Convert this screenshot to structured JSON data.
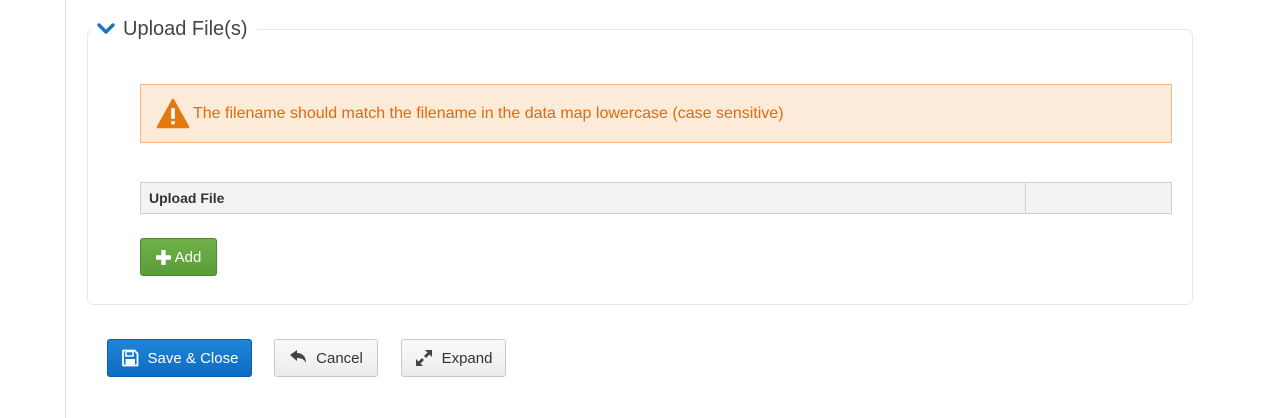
{
  "section": {
    "title": "Upload File(s)",
    "toggle_icon": "chevron-down-icon",
    "accent_color": "#1a73c5"
  },
  "alert": {
    "icon": "warning-triangle-icon",
    "message": "The filename should match the filename in the data map lowercase (case sensitive)",
    "text_color": "#e06b0c",
    "background": "#fdebd9"
  },
  "upload_table": {
    "columns": [
      "Upload File",
      ""
    ]
  },
  "add_button": {
    "label": "Add",
    "icon": "plus-icon",
    "color": "#62a640"
  },
  "actions": {
    "save_close": {
      "label": "Save & Close",
      "icon": "floppy-disk-icon",
      "color": "#1479cf"
    },
    "cancel": {
      "label": "Cancel",
      "icon": "undo-arrow-icon"
    },
    "expand": {
      "label": "Expand",
      "icon": "expand-arrows-icon"
    }
  }
}
